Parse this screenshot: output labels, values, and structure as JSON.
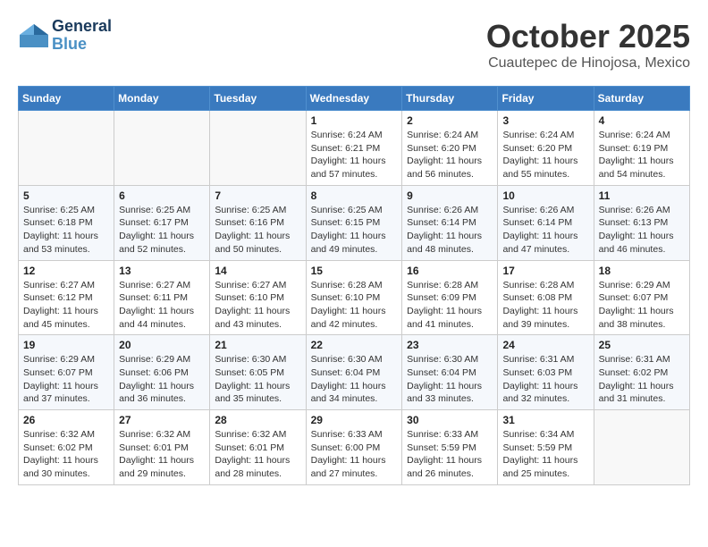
{
  "header": {
    "logo_line1": "General",
    "logo_line2": "Blue",
    "month": "October 2025",
    "location": "Cuautepec de Hinojosa, Mexico"
  },
  "days_of_week": [
    "Sunday",
    "Monday",
    "Tuesday",
    "Wednesday",
    "Thursday",
    "Friday",
    "Saturday"
  ],
  "weeks": [
    [
      {
        "day": "",
        "info": ""
      },
      {
        "day": "",
        "info": ""
      },
      {
        "day": "",
        "info": ""
      },
      {
        "day": "1",
        "info": "Sunrise: 6:24 AM\nSunset: 6:21 PM\nDaylight: 11 hours and 57 minutes."
      },
      {
        "day": "2",
        "info": "Sunrise: 6:24 AM\nSunset: 6:20 PM\nDaylight: 11 hours and 56 minutes."
      },
      {
        "day": "3",
        "info": "Sunrise: 6:24 AM\nSunset: 6:20 PM\nDaylight: 11 hours and 55 minutes."
      },
      {
        "day": "4",
        "info": "Sunrise: 6:24 AM\nSunset: 6:19 PM\nDaylight: 11 hours and 54 minutes."
      }
    ],
    [
      {
        "day": "5",
        "info": "Sunrise: 6:25 AM\nSunset: 6:18 PM\nDaylight: 11 hours and 53 minutes."
      },
      {
        "day": "6",
        "info": "Sunrise: 6:25 AM\nSunset: 6:17 PM\nDaylight: 11 hours and 52 minutes."
      },
      {
        "day": "7",
        "info": "Sunrise: 6:25 AM\nSunset: 6:16 PM\nDaylight: 11 hours and 50 minutes."
      },
      {
        "day": "8",
        "info": "Sunrise: 6:25 AM\nSunset: 6:15 PM\nDaylight: 11 hours and 49 minutes."
      },
      {
        "day": "9",
        "info": "Sunrise: 6:26 AM\nSunset: 6:14 PM\nDaylight: 11 hours and 48 minutes."
      },
      {
        "day": "10",
        "info": "Sunrise: 6:26 AM\nSunset: 6:14 PM\nDaylight: 11 hours and 47 minutes."
      },
      {
        "day": "11",
        "info": "Sunrise: 6:26 AM\nSunset: 6:13 PM\nDaylight: 11 hours and 46 minutes."
      }
    ],
    [
      {
        "day": "12",
        "info": "Sunrise: 6:27 AM\nSunset: 6:12 PM\nDaylight: 11 hours and 45 minutes."
      },
      {
        "day": "13",
        "info": "Sunrise: 6:27 AM\nSunset: 6:11 PM\nDaylight: 11 hours and 44 minutes."
      },
      {
        "day": "14",
        "info": "Sunrise: 6:27 AM\nSunset: 6:10 PM\nDaylight: 11 hours and 43 minutes."
      },
      {
        "day": "15",
        "info": "Sunrise: 6:28 AM\nSunset: 6:10 PM\nDaylight: 11 hours and 42 minutes."
      },
      {
        "day": "16",
        "info": "Sunrise: 6:28 AM\nSunset: 6:09 PM\nDaylight: 11 hours and 41 minutes."
      },
      {
        "day": "17",
        "info": "Sunrise: 6:28 AM\nSunset: 6:08 PM\nDaylight: 11 hours and 39 minutes."
      },
      {
        "day": "18",
        "info": "Sunrise: 6:29 AM\nSunset: 6:07 PM\nDaylight: 11 hours and 38 minutes."
      }
    ],
    [
      {
        "day": "19",
        "info": "Sunrise: 6:29 AM\nSunset: 6:07 PM\nDaylight: 11 hours and 37 minutes."
      },
      {
        "day": "20",
        "info": "Sunrise: 6:29 AM\nSunset: 6:06 PM\nDaylight: 11 hours and 36 minutes."
      },
      {
        "day": "21",
        "info": "Sunrise: 6:30 AM\nSunset: 6:05 PM\nDaylight: 11 hours and 35 minutes."
      },
      {
        "day": "22",
        "info": "Sunrise: 6:30 AM\nSunset: 6:04 PM\nDaylight: 11 hours and 34 minutes."
      },
      {
        "day": "23",
        "info": "Sunrise: 6:30 AM\nSunset: 6:04 PM\nDaylight: 11 hours and 33 minutes."
      },
      {
        "day": "24",
        "info": "Sunrise: 6:31 AM\nSunset: 6:03 PM\nDaylight: 11 hours and 32 minutes."
      },
      {
        "day": "25",
        "info": "Sunrise: 6:31 AM\nSunset: 6:02 PM\nDaylight: 11 hours and 31 minutes."
      }
    ],
    [
      {
        "day": "26",
        "info": "Sunrise: 6:32 AM\nSunset: 6:02 PM\nDaylight: 11 hours and 30 minutes."
      },
      {
        "day": "27",
        "info": "Sunrise: 6:32 AM\nSunset: 6:01 PM\nDaylight: 11 hours and 29 minutes."
      },
      {
        "day": "28",
        "info": "Sunrise: 6:32 AM\nSunset: 6:01 PM\nDaylight: 11 hours and 28 minutes."
      },
      {
        "day": "29",
        "info": "Sunrise: 6:33 AM\nSunset: 6:00 PM\nDaylight: 11 hours and 27 minutes."
      },
      {
        "day": "30",
        "info": "Sunrise: 6:33 AM\nSunset: 5:59 PM\nDaylight: 11 hours and 26 minutes."
      },
      {
        "day": "31",
        "info": "Sunrise: 6:34 AM\nSunset: 5:59 PM\nDaylight: 11 hours and 25 minutes."
      },
      {
        "day": "",
        "info": ""
      }
    ]
  ]
}
